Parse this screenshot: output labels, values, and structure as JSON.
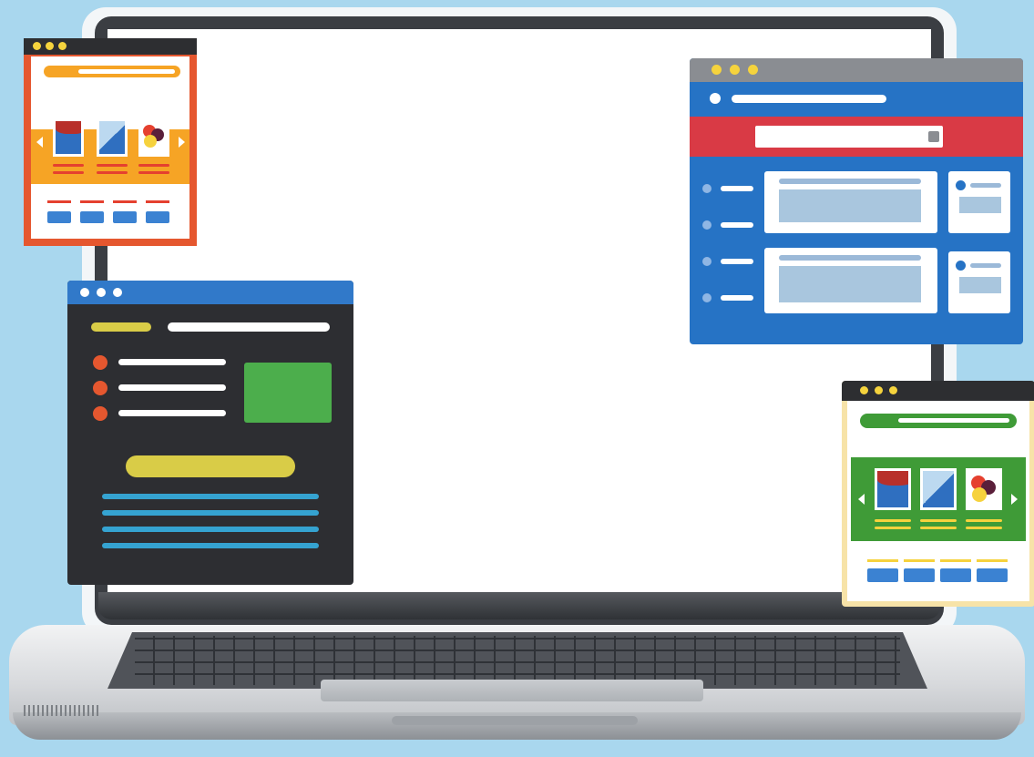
{
  "scene": {
    "background": "#a9d7ee"
  },
  "windows": [
    {
      "id": "orange-gallery-window",
      "accent": "#e5572f",
      "body": "#f6a425"
    },
    {
      "id": "blue-dashboard-window",
      "accent": "#2673c5",
      "search": "#d93a45"
    },
    {
      "id": "dark-content-window",
      "accent": "#2d2e32",
      "header": "#3179c9",
      "highlight": "#4cae4c"
    },
    {
      "id": "green-gallery-window",
      "accent": "#f7e3a8",
      "body": "#3f9b37"
    }
  ],
  "icons": [
    "search-icon",
    "chevron-left-icon",
    "chevron-right-icon",
    "image-thumbnail-icon",
    "bullet-icon"
  ]
}
